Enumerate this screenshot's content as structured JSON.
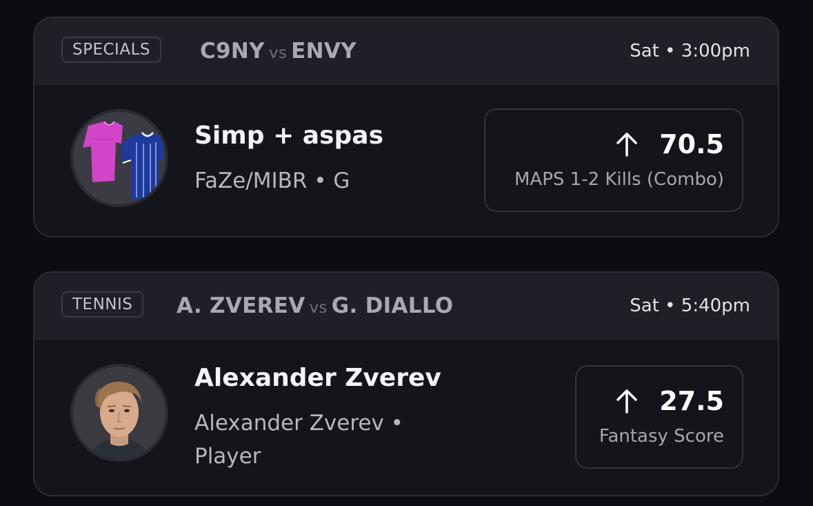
{
  "cards": [
    {
      "category": "SPECIALS",
      "team_a": "C9NY",
      "vs": "vs",
      "team_b": "ENVY",
      "time": "Sat • 3:00pm",
      "player_name": "Simp + aspas",
      "player_sub": "FaZe/MIBR • G",
      "arrow": "arrow-up-icon",
      "line": "70.5",
      "stat": "MAPS 1-2 Kills (Combo)",
      "avatar": "jerseys-icon",
      "jersey_colors": [
        "#d245c8",
        "#1f3a9a"
      ]
    },
    {
      "category": "TENNIS",
      "team_a": "A. ZVEREV",
      "vs": "vs",
      "team_b": "G. DIALLO",
      "time": "Sat • 5:40pm",
      "player_name": "Alexander Zverev",
      "player_sub_line1": "Alexander Zverev •",
      "player_sub_line2": "Player",
      "arrow": "arrow-up-icon",
      "line": "27.5",
      "stat": "Fantasy Score",
      "avatar": "player-headshot"
    }
  ],
  "colors": {
    "background": "#0c0c12",
    "card": "#14141b",
    "header": "#1f1f27",
    "text_primary": "#f4f4f7",
    "text_secondary": "#b7b7c0"
  }
}
